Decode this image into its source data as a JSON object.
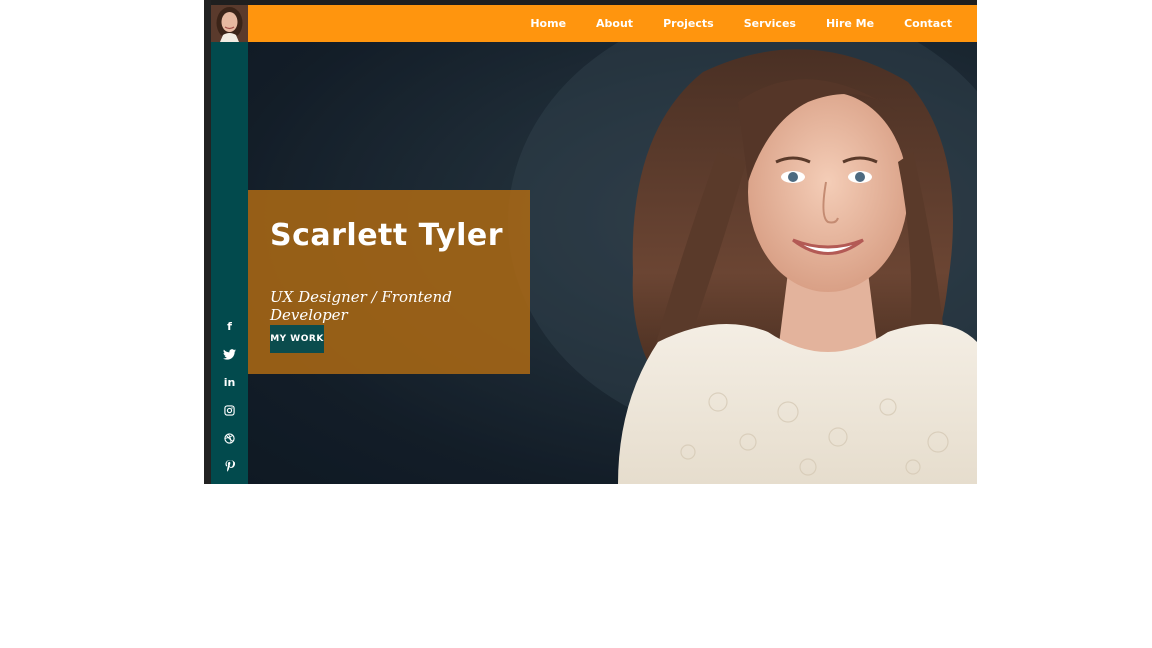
{
  "profile": {
    "name": "Scarlett Tyler",
    "tagline": "UX Designer / Frontend Developer",
    "cta_label": "MY WORK"
  },
  "nav": {
    "items": [
      {
        "label": "Home"
      },
      {
        "label": "About"
      },
      {
        "label": "Projects"
      },
      {
        "label": "Services"
      },
      {
        "label": "Hire Me"
      },
      {
        "label": "Contact"
      }
    ]
  },
  "social": {
    "icons": [
      {
        "name": "facebook-icon",
        "glyph": "f"
      },
      {
        "name": "twitter-icon",
        "glyph": "🐦"
      },
      {
        "name": "linkedin-icon",
        "glyph": "in"
      },
      {
        "name": "instagram-icon",
        "glyph": "◎"
      },
      {
        "name": "dribbble-icon",
        "glyph": "⊛"
      },
      {
        "name": "pinterest-icon",
        "glyph": "℗"
      }
    ]
  },
  "colors": {
    "topbar": "#ff950e",
    "sidebar": "#024a4d",
    "card": "#a86814",
    "button": "#0b4c4d"
  }
}
